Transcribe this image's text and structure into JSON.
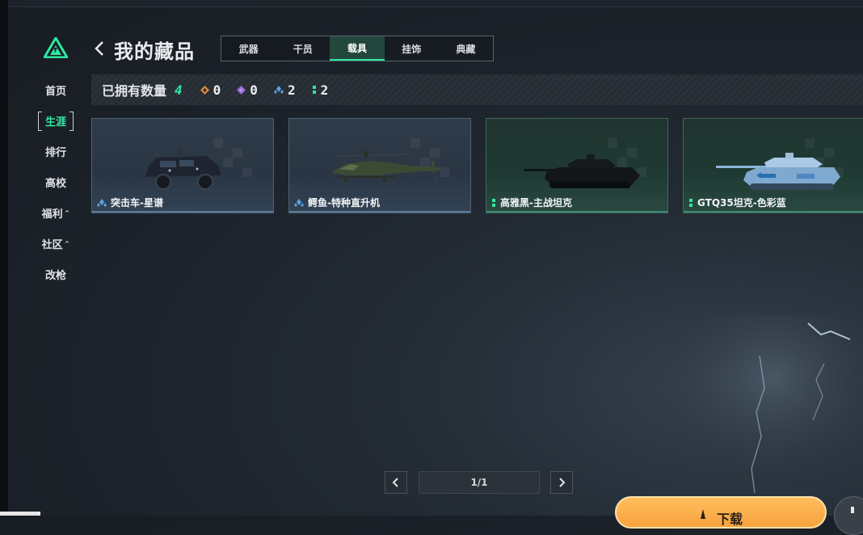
{
  "sidebar": {
    "items": [
      {
        "label": "首页",
        "caret": ""
      },
      {
        "label": "生涯",
        "caret": "",
        "active": true
      },
      {
        "label": "排行",
        "caret": ""
      },
      {
        "label": "高校",
        "caret": ""
      },
      {
        "label": "福利",
        "caret": "^"
      },
      {
        "label": "社区",
        "caret": "^"
      },
      {
        "label": "改枪",
        "caret": ""
      }
    ]
  },
  "header": {
    "title": "我的藏品",
    "tabs": [
      {
        "label": "武器"
      },
      {
        "label": "干员"
      },
      {
        "label": "载具",
        "active": true
      },
      {
        "label": "挂饰"
      },
      {
        "label": "典藏"
      }
    ]
  },
  "counts": {
    "label": "已拥有数量",
    "total": "4",
    "stats": [
      {
        "icon": "orange-rarity-icon",
        "value": "0"
      },
      {
        "icon": "purple-rarity-icon",
        "value": "0"
      },
      {
        "icon": "blue-rarity-icon",
        "value": "2"
      },
      {
        "icon": "green-rarity-icon",
        "value": "2"
      }
    ]
  },
  "items": [
    {
      "name": "突击车-星谱",
      "rarity": "blue",
      "vehicle": "assault-vehicle"
    },
    {
      "name": "鳄鱼-特种直升机",
      "rarity": "blue",
      "vehicle": "helicopter"
    },
    {
      "name": "高雅黑-主战坦克",
      "rarity": "green",
      "vehicle": "tank-black"
    },
    {
      "name": "GTQ35坦克-色彩蓝",
      "rarity": "green",
      "vehicle": "tank-blue"
    }
  ],
  "pager": {
    "indicator": "1/1"
  },
  "bottom": {
    "button_text": "下载"
  },
  "colors": {
    "accent": "#2ee8a0",
    "blue_rarity": "#5aa0e0",
    "green_rarity": "#2ee8a0",
    "orange_button": "#f7a23e"
  }
}
